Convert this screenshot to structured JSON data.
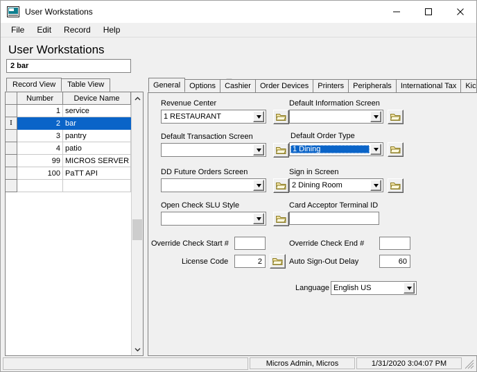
{
  "window": {
    "title": "User Workstations",
    "icon": "workstation-icon",
    "controls": {
      "minimize": "minimize-icon",
      "maximize": "maximize-icon",
      "close": "close-icon"
    }
  },
  "menubar": {
    "items": [
      "File",
      "Edit",
      "Record",
      "Help"
    ]
  },
  "header": {
    "page_title": "User Workstations",
    "record_field_value": "2 bar"
  },
  "toolbar": {
    "row1": [
      {
        "name": "new-record-icon",
        "enabled": false
      },
      {
        "name": "copy-record-icon",
        "enabled": false
      },
      {
        "name": "paste-record-icon",
        "enabled": false
      },
      {
        "name": "delete-record-icon",
        "enabled": false
      },
      {
        "name": "cut-record-icon",
        "enabled": false
      },
      {
        "name": "duplicate-record-icon",
        "enabled": false
      },
      {
        "name": "blank-record-icon",
        "enabled": false
      },
      {
        "name": "sort-records-icon",
        "enabled": true
      }
    ],
    "row2": [
      {
        "name": "first-record-icon",
        "enabled": true
      },
      {
        "name": "previous-record-icon",
        "enabled": true
      },
      {
        "name": "next-record-icon",
        "enabled": true
      },
      {
        "name": "last-record-icon",
        "enabled": true
      },
      {
        "name": "save-record-icon",
        "enabled": true
      },
      {
        "name": "undo-icon",
        "enabled": true
      },
      {
        "name": "add-record-icon",
        "enabled": true
      },
      {
        "name": "remove-record-icon",
        "enabled": true
      }
    ],
    "right_row1": [
      {
        "name": "find-binoculars-icon",
        "enabled": true
      },
      {
        "name": "help-book-icon",
        "enabled": true
      },
      {
        "name": "whats-this-help-icon",
        "enabled": true
      }
    ],
    "right_row2": [
      {
        "name": "workstation-monitor-icon",
        "enabled": true
      },
      {
        "name": "sync-transfer-icon",
        "enabled": true
      }
    ]
  },
  "left_pane": {
    "tabs": [
      {
        "label": "Record View",
        "active": true
      },
      {
        "label": "Table View",
        "active": false
      }
    ],
    "grid": {
      "columns": [
        "Number",
        "Device Name"
      ],
      "rows": [
        {
          "number": "1",
          "device_name": "service",
          "selected": false
        },
        {
          "number": "2",
          "device_name": "bar",
          "selected": true
        },
        {
          "number": "3",
          "device_name": "pantry",
          "selected": false
        },
        {
          "number": "4",
          "device_name": "patio",
          "selected": false
        },
        {
          "number": "99",
          "device_name": "MICROS SERVER",
          "selected": false
        },
        {
          "number": "100",
          "device_name": "PaTT API",
          "selected": false
        }
      ]
    },
    "scrollbar": {
      "up": "scroll-up-icon",
      "down": "scroll-down-icon"
    }
  },
  "right_pane": {
    "tabs": [
      {
        "label": "General",
        "active": true
      },
      {
        "label": "Options",
        "active": false
      },
      {
        "label": "Cashier",
        "active": false
      },
      {
        "label": "Order Devices",
        "active": false
      },
      {
        "label": "Printers",
        "active": false
      },
      {
        "label": "Peripherals",
        "active": false
      },
      {
        "label": "International Tax",
        "active": false
      },
      {
        "label": "Kic",
        "active": false,
        "clipped": true
      }
    ],
    "tab_scroll": {
      "left": "◄",
      "right": "►"
    },
    "form": {
      "revenue_center": {
        "label": "Revenue Center",
        "value": "1  RESTAURANT"
      },
      "default_information_screen": {
        "label": "Default Information Screen",
        "value": ""
      },
      "default_transaction_screen": {
        "label": "Default Transaction Screen",
        "value": ""
      },
      "default_order_type": {
        "label": "Default Order Type",
        "value": "1  Dining",
        "selected": true
      },
      "dd_future_orders_screen": {
        "label": "DD Future Orders Screen",
        "value": ""
      },
      "sign_in_screen": {
        "label": "Sign in Screen",
        "value": "2  Dining Room"
      },
      "open_check_slu_style": {
        "label": "Open Check SLU Style",
        "value": ""
      },
      "card_acceptor_terminal_id": {
        "label": "Card Acceptor Terminal ID",
        "value": ""
      },
      "override_check_start": {
        "label": "Override Check Start #",
        "value": ""
      },
      "override_check_end": {
        "label": "Override Check End #",
        "value": ""
      },
      "license_code": {
        "label": "License Code",
        "value": "2"
      },
      "auto_sign_out_delay": {
        "label": "Auto Sign-Out Delay",
        "value": "60"
      },
      "language": {
        "label": "Language",
        "value": "English US"
      }
    }
  },
  "statusbar": {
    "message": "",
    "user": "Micros Admin, Micros",
    "datetime": "1/31/2020 3:04:07 PM"
  },
  "colors": {
    "selection_blue": "#0a64c8",
    "window_bg": "#f0f0f0",
    "field_bg": "#ffffff",
    "border": "#828282"
  }
}
